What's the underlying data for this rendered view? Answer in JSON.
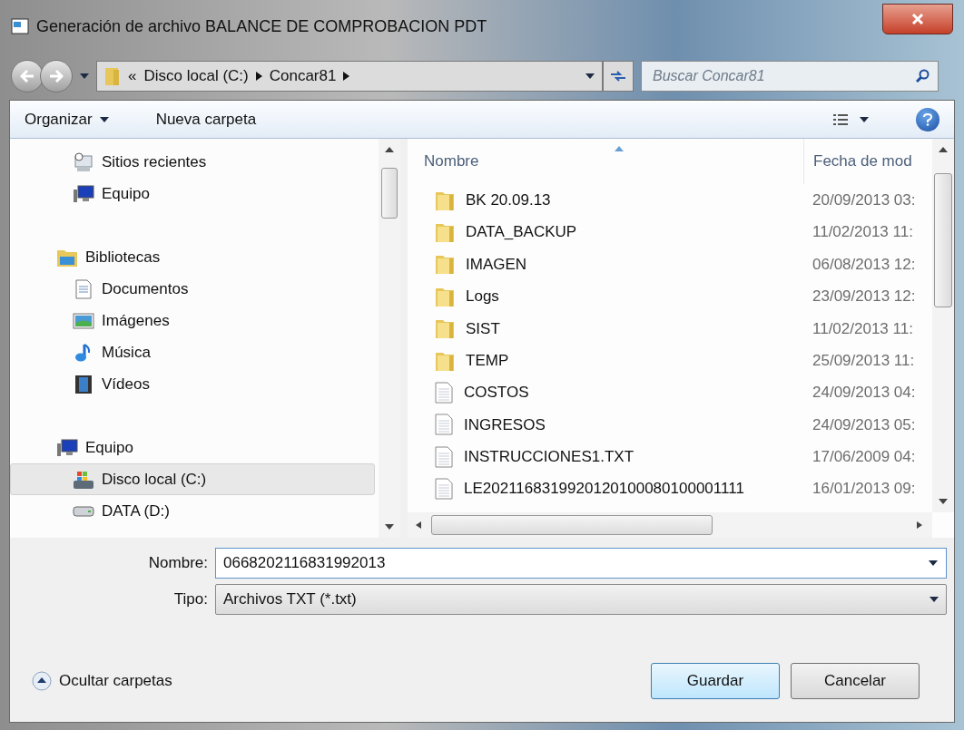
{
  "window": {
    "title": "Generación de archivo BALANCE DE COMPROBACION PDT"
  },
  "address": {
    "overflow": "«",
    "path": [
      "Disco local (C:)",
      "Concar81"
    ]
  },
  "search": {
    "placeholder": "Buscar Concar81"
  },
  "toolbar": {
    "organize": "Organizar",
    "new_folder": "Nueva carpeta"
  },
  "nav": [
    {
      "label": "Sitios recientes",
      "kind": "child",
      "selected": false
    },
    {
      "label": "Equipo",
      "kind": "child",
      "selected": false
    },
    {
      "label": "Bibliotecas",
      "kind": "header",
      "selected": false
    },
    {
      "label": "Documentos",
      "kind": "child",
      "selected": false
    },
    {
      "label": "Imágenes",
      "kind": "child",
      "selected": false
    },
    {
      "label": "Música",
      "kind": "child",
      "selected": false
    },
    {
      "label": "Vídeos",
      "kind": "child",
      "selected": false
    },
    {
      "label": "Equipo",
      "kind": "header",
      "selected": false
    },
    {
      "label": "Disco local (C:)",
      "kind": "child",
      "selected": true
    },
    {
      "label": "DATA (D:)",
      "kind": "child",
      "selected": false
    }
  ],
  "table": {
    "columns": [
      "Nombre",
      "Fecha de mod"
    ],
    "rows": [
      {
        "kind": "folder",
        "name": "BK 20.09.13",
        "date": "20/09/2013 03:"
      },
      {
        "kind": "folder",
        "name": "DATA_BACKUP",
        "date": "11/02/2013 11:"
      },
      {
        "kind": "folder",
        "name": "IMAGEN",
        "date": "06/08/2013 12:"
      },
      {
        "kind": "folder",
        "name": "Logs",
        "date": "23/09/2013 12:"
      },
      {
        "kind": "folder",
        "name": "SIST",
        "date": "11/02/2013 11:"
      },
      {
        "kind": "folder",
        "name": "TEMP",
        "date": "25/09/2013 11:"
      },
      {
        "kind": "file",
        "name": "COSTOS",
        "date": "24/09/2013 04:"
      },
      {
        "kind": "file",
        "name": "INGRESOS",
        "date": "24/09/2013 05:"
      },
      {
        "kind": "file",
        "name": "INSTRUCCIONES1.TXT",
        "date": "17/06/2009 04:"
      },
      {
        "kind": "file",
        "name": "LE2021168319920120100080100001111",
        "date": "16/01/2013 09:"
      }
    ]
  },
  "filename": {
    "label": "Nombre:",
    "value": "0668202116831992013"
  },
  "filetype": {
    "label": "Tipo:",
    "value": "Archivos TXT (*.txt)"
  },
  "hide_folders": "Ocultar carpetas",
  "buttons": {
    "save": "Guardar",
    "cancel": "Cancelar"
  }
}
